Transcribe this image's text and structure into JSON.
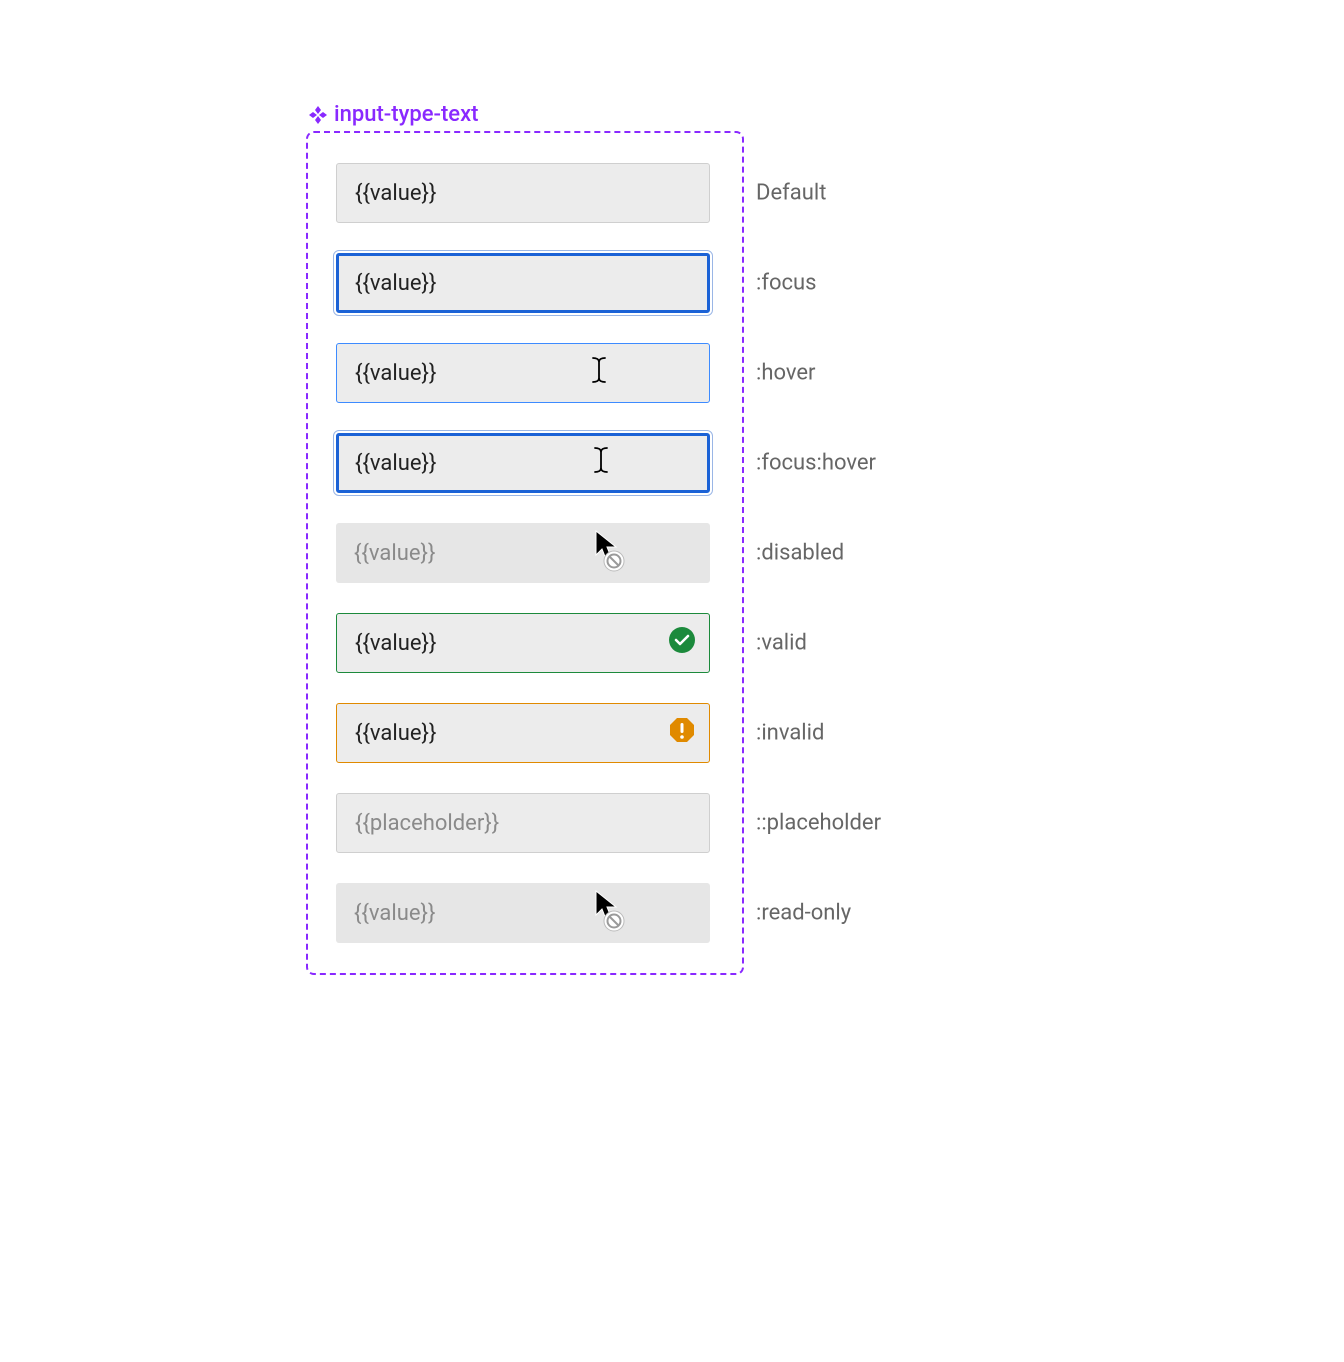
{
  "component_name": "input-type-text",
  "value_text": "{{value}}",
  "placeholder_text": "{{placeholder}}",
  "states": {
    "default": "Default",
    "focus": ":focus",
    "hover": ":hover",
    "focus_hover": ":focus:hover",
    "disabled": ":disabled",
    "valid": ":valid",
    "invalid": ":invalid",
    "placeholder": "::placeholder",
    "readonly": ":read-only"
  },
  "colors": {
    "accent": "#8929ff",
    "focus_border": "#1b62d6",
    "hover_border": "#3d8bff",
    "valid_border": "#1c8a3c",
    "invalid_border": "#e08a00",
    "input_bg": "#ececec",
    "text": "#222222",
    "muted_text": "#8a8a8a",
    "label_text": "#666666"
  }
}
